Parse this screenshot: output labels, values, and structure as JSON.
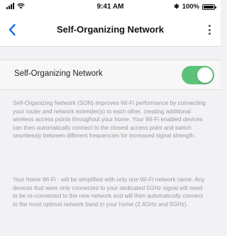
{
  "status_bar": {
    "time": "9:41 AM",
    "battery_percent": "100%",
    "battery_level": 1.0,
    "bluetooth_symbol": "✱"
  },
  "nav": {
    "title": "Self-Organizing Network",
    "back_icon": "chevron-left-icon",
    "more_icon": "more-vertical-icon"
  },
  "setting": {
    "label": "Self-Organizing Network",
    "enabled": true,
    "toggle_color": "#5cc27a"
  },
  "descriptions": [
    "Self-Organizing Network (SON) improves Wi-Fi performance by connecting your router and network extender(s) to each other, creating additional wireless access points throughout your home. Your Wi-Fi enabled devices can then automatically connect to the closest access point and switch seamlessly between different frequencies for increased signal strength.",
    "Your home Wi-Fi - will be simplified with only one Wi-Fi network name. Any devices that were only connected to your dedicated 5GHz signal will need to be re-connected to the new network and will then automatically connect to the most optimal network band in your home (2.4GHz and 5GHz)."
  ],
  "colors": {
    "accent_blue": "#1a73e8",
    "background": "#f2f2f4",
    "description_text": "#9a9a9e"
  }
}
